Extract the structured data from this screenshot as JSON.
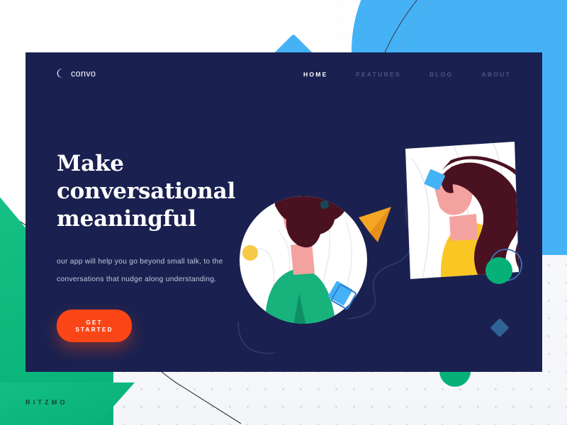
{
  "brand": {
    "logo_icon": "crescent-moon-icon",
    "logo_text": "convo",
    "footer_mark": "RITZMO"
  },
  "nav": {
    "items": [
      {
        "label": "HOME",
        "active": true
      },
      {
        "label": "FEATURES",
        "active": false
      },
      {
        "label": "BLOG",
        "active": false
      },
      {
        "label": "ABOUT",
        "active": false
      }
    ]
  },
  "hero": {
    "headline_line1": "Make conversational",
    "headline_line2": "meaningful",
    "subcopy": "our app will help you go beyond small talk, to the conversations that nudge along understanding.",
    "cta_label": "GET STARTED"
  },
  "illustration": {
    "scene_left": "person-in-circle-portrait",
    "scene_right": "woman-with-long-hair-framed-photo",
    "messenger": "paper-plane-icon"
  },
  "colors": {
    "card_navy": "#1a2150",
    "accent_orange": "#fa4616",
    "accent_blue": "#45b2f6",
    "accent_green": "#06b177",
    "accent_yellow": "#f7c948",
    "hair_maroon": "#4a1221",
    "skin_pink": "#f4a2a0",
    "page_bg": "#f4f5f8",
    "nav_muted": "#4b5480"
  }
}
